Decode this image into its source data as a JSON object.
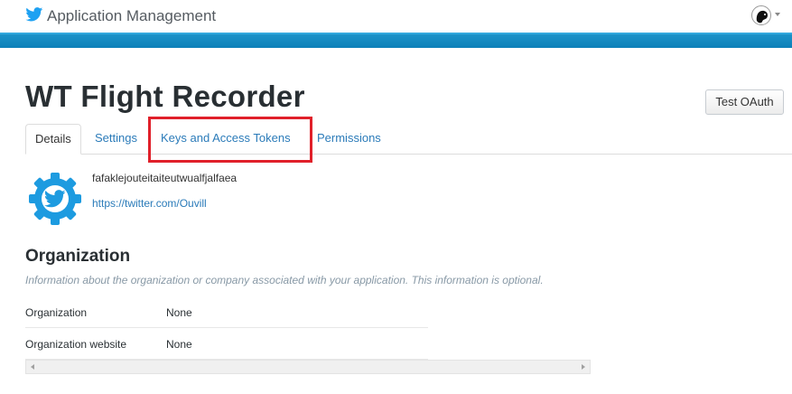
{
  "header": {
    "title": "Application Management",
    "logo_icon": "twitter-bird-icon",
    "brand_color": "#1da1f2",
    "bar_color": "#1c93c9"
  },
  "app": {
    "name": "WT Flight Recorder",
    "description": "fafaklejouteitaiteutwualfjalfaea",
    "url": "https://twitter.com/Ouvill"
  },
  "actions": {
    "test_oauth_label": "Test OAuth"
  },
  "tabs": [
    {
      "label": "Details",
      "active": true
    },
    {
      "label": "Settings",
      "active": false
    },
    {
      "label": "Keys and Access Tokens",
      "active": false,
      "highlighted": true
    },
    {
      "label": "Permissions",
      "active": false
    }
  ],
  "highlight_color": "#e0202a",
  "organization": {
    "heading": "Organization",
    "info": "Information about the organization or company associated with your application. This information is optional.",
    "rows": [
      {
        "label": "Organization",
        "value": "None"
      },
      {
        "label": "Organization website",
        "value": "None"
      }
    ]
  }
}
